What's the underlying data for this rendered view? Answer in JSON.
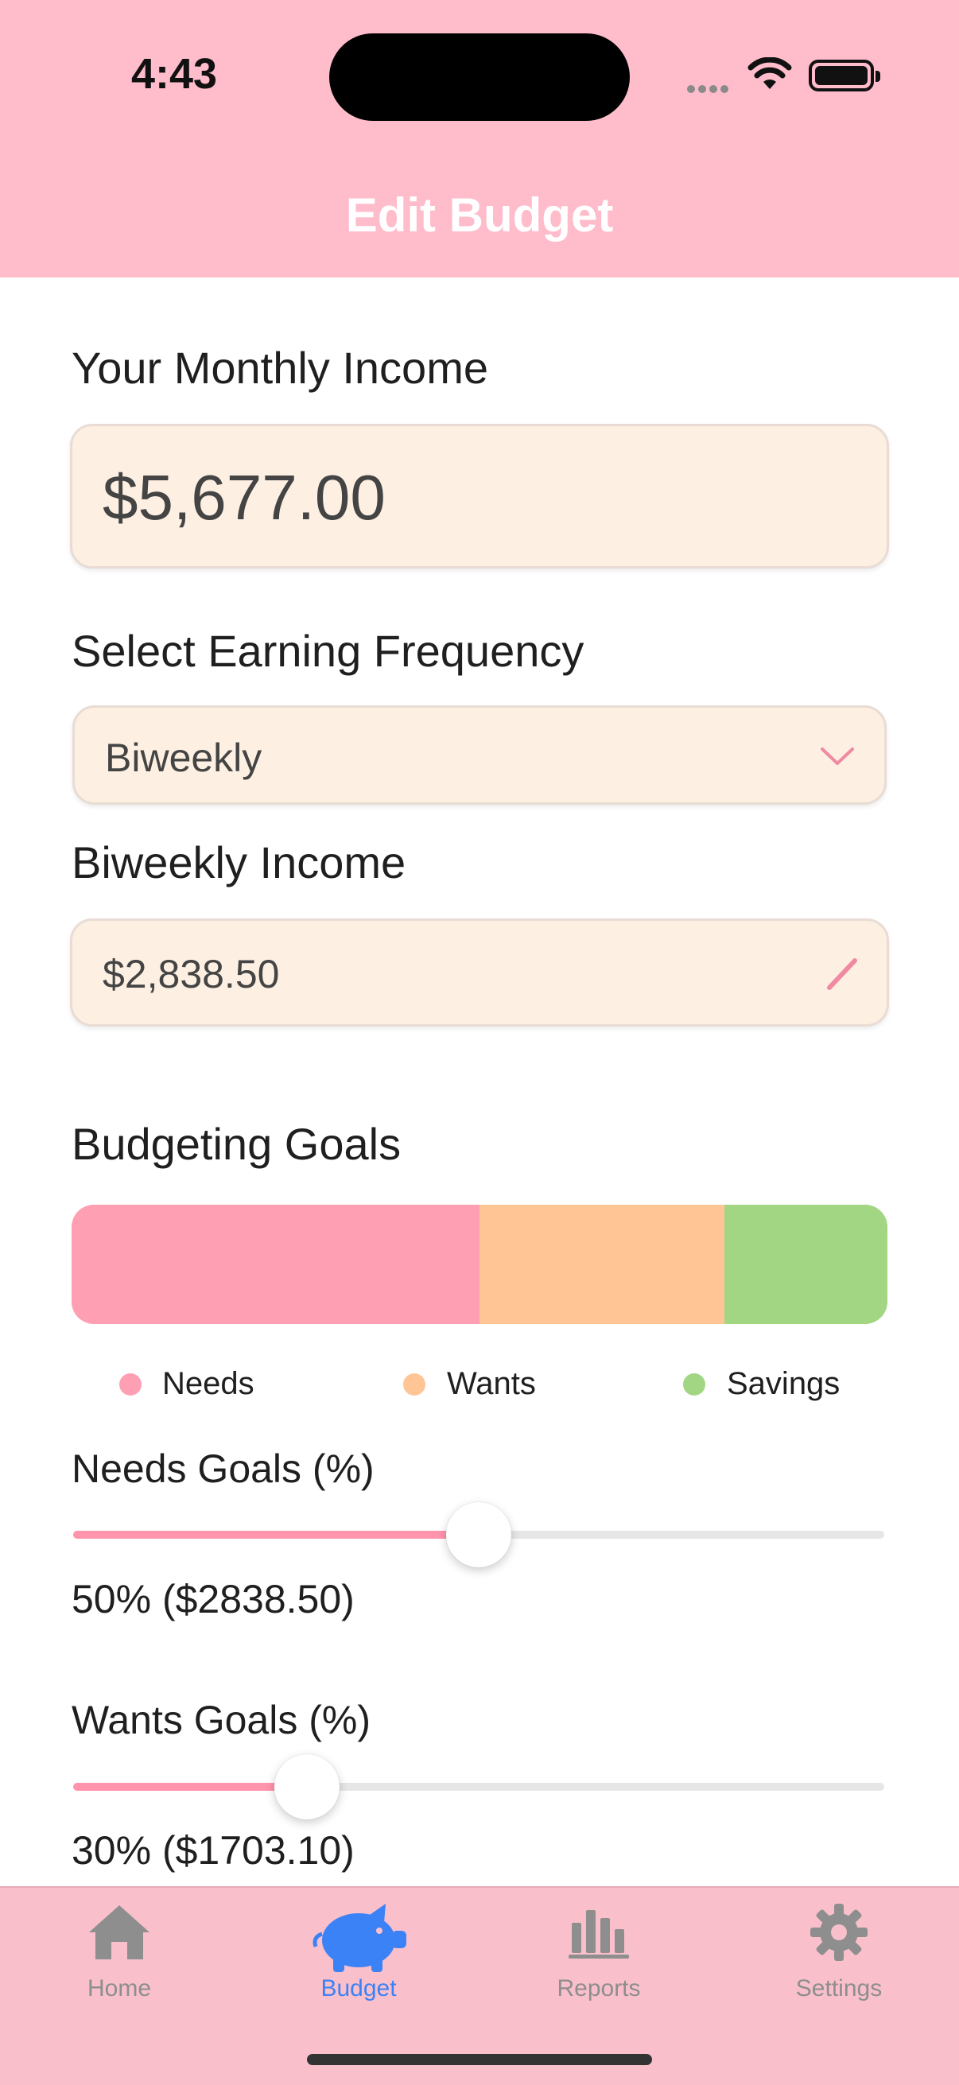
{
  "status": {
    "time": "4:43"
  },
  "header": {
    "title": "Edit Budget"
  },
  "income": {
    "label": "Your Monthly Income",
    "value": "$5,677.00"
  },
  "frequency": {
    "label": "Select Earning Frequency",
    "selected": "Biweekly"
  },
  "periodIncome": {
    "label": "Biweekly Income",
    "value": "$2,838.50"
  },
  "goals": {
    "title": "Budgeting Goals",
    "segments": [
      {
        "name": "Needs",
        "percent": 50,
        "color": "#ff9fb4"
      },
      {
        "name": "Wants",
        "percent": 30,
        "color": "#ffc595"
      },
      {
        "name": "Savings",
        "percent": 20,
        "color": "#a2d682"
      }
    ]
  },
  "legend": {
    "needs": "Needs",
    "wants": "Wants",
    "savings": "Savings"
  },
  "needsSlider": {
    "label": "Needs Goals (%)",
    "percent": 50,
    "value_text": "50% ($2838.50)"
  },
  "wantsSlider": {
    "label": "Wants Goals (%)",
    "percent": 30,
    "value_text": "30% ($1703.10)"
  },
  "tabs": [
    {
      "label": "Home",
      "icon": "house-icon",
      "active": false
    },
    {
      "label": "Budget",
      "icon": "piggy-bank-icon",
      "active": true
    },
    {
      "label": "Reports",
      "icon": "bar-chart-icon",
      "active": false
    },
    {
      "label": "Settings",
      "icon": "gear-icon",
      "active": false
    }
  ],
  "colors": {
    "header": "#ffbccb",
    "accent": "#ff94ac",
    "field": "#fdf0e2",
    "activeTab": "#3b82f6",
    "tabbar": "#f9c0cc"
  }
}
